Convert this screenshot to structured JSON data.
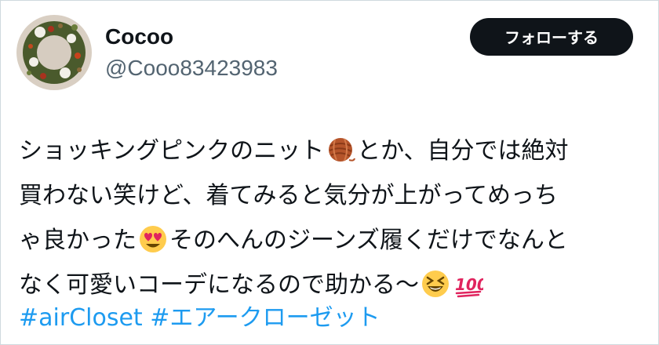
{
  "user": {
    "display_name": "Cocoo",
    "handle": "@Cooo83423983",
    "avatar_icon": "wreath-avatar"
  },
  "follow_button": {
    "label": "フォローする"
  },
  "tweet": {
    "segments": [
      "ショッキングピンクのニット",
      "とか、自分では絶対",
      "買わない笑けど、着てみると気分が上がってめっち",
      "ゃ良かった",
      "そのへんのジーンズ履くだけでなんと",
      "なく可愛いコーデになるので助かる〜"
    ],
    "emojis": [
      "yarn-emoji",
      "heart-eyes-emoji",
      "grinning-squinting-emoji",
      "hundred-points-emoji"
    ],
    "hashtags": [
      "#airCloset",
      "#エアークローゼット"
    ]
  },
  "colors": {
    "text": "#0f1419",
    "secondary": "#536471",
    "link": "#1d9bf0",
    "button_bg": "#0f1419",
    "button_text": "#ffffff"
  }
}
